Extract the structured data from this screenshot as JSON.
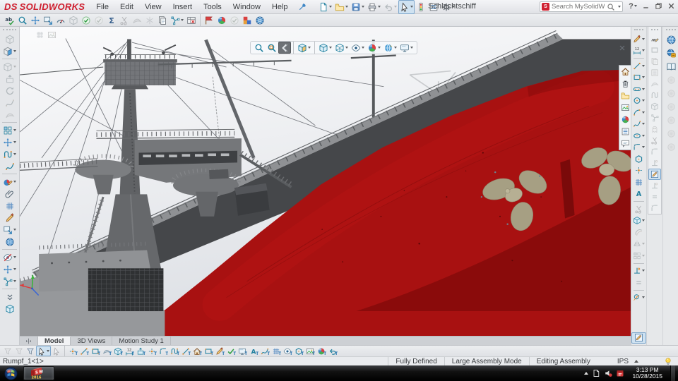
{
  "window": {
    "logo_prefix": "DS",
    "logo_name": "SOLIDWORKS",
    "title": "Schlachtschiff",
    "menus": [
      "File",
      "Edit",
      "View",
      "Insert",
      "Tools",
      "Window",
      "Help"
    ],
    "search_placeholder": "Search MySolidWorks",
    "search_chip": "S",
    "help_label": "?"
  },
  "quick_toolbar": [
    {
      "n": "new-document",
      "g": "page",
      "dd": 1
    },
    {
      "n": "open-document",
      "g": "folder",
      "dd": 1
    },
    {
      "n": "save",
      "g": "floppy",
      "dd": 1
    },
    {
      "n": "print",
      "g": "printer",
      "dd": 1
    },
    {
      "n": "undo",
      "g": "undo",
      "dd": 1,
      "dis": 1
    },
    {
      "n": "select",
      "g": "cursor",
      "dd": 1,
      "sel": 1
    },
    {
      "n": "rebuild",
      "g": "traffic"
    },
    {
      "n": "file-properties",
      "g": "list"
    },
    {
      "n": "options",
      "g": "gear",
      "dd": 1
    }
  ],
  "menu_toolbar": [
    {
      "n": "spell-checker",
      "g": "spell"
    },
    {
      "n": "design-checker",
      "g": "mag"
    },
    {
      "n": "move-component",
      "g": "move"
    },
    {
      "n": "replace-components",
      "g": "windowarrow"
    },
    {
      "n": "measure",
      "g": "gauge"
    },
    {
      "n": "interference-detection",
      "g": "cube",
      "dis": 1
    },
    {
      "n": "check-active-document",
      "g": "checkc"
    },
    {
      "n": "deviation-analysis",
      "g": "checkc",
      "dis": 1
    },
    {
      "n": "equations",
      "g": "sigma"
    },
    {
      "n": "trim-entities",
      "g": "scissors",
      "dis": 1
    },
    {
      "n": "surface-tool",
      "g": "wing",
      "dis": 1
    },
    {
      "n": "freeze-bar",
      "g": "snow",
      "dis": 1
    },
    {
      "n": "copy-settings-wizard",
      "g": "copy"
    },
    {
      "n": "exploded-view",
      "g": "explode",
      "dd": 1
    },
    {
      "n": "delete-face",
      "g": "tablex"
    },
    {
      "sep": 1
    },
    {
      "n": "photoview-preview",
      "g": "flag"
    },
    {
      "n": "motion-manager",
      "g": "ball"
    },
    {
      "n": "verification",
      "g": "checkc",
      "dis": 1
    },
    {
      "n": "edrawings",
      "g": "squares"
    },
    {
      "n": "solidworks-web-help",
      "g": "globe"
    }
  ],
  "left_toolbar": [
    {
      "n": "edit-part",
      "g": "cube",
      "dis": 1
    },
    {
      "n": "edit-component",
      "g": "cube2",
      "dd": 1
    },
    {
      "sep": 1
    },
    {
      "n": "insert-components",
      "g": "cube",
      "dd": 1,
      "dis": 1
    },
    {
      "n": "extruded-boss",
      "g": "extrude",
      "dis": 1
    },
    {
      "n": "revolved-boss",
      "g": "rotate",
      "dis": 1
    },
    {
      "n": "swept-boss",
      "g": "spline",
      "dis": 1
    },
    {
      "n": "lofted-boss",
      "g": "wing",
      "dis": 1
    },
    {
      "sep": 1
    },
    {
      "n": "linear-component-pattern",
      "g": "pattern",
      "dd": 1
    },
    {
      "n": "move-component-tool",
      "g": "move",
      "dd": 1
    },
    {
      "n": "routing-line",
      "g": "route",
      "dd": 1
    },
    {
      "n": "belt-chain",
      "g": "spline"
    },
    {
      "sep": 1
    },
    {
      "n": "edit-appearance",
      "g": "ballpencil",
      "dd": 1
    },
    {
      "n": "attachments",
      "g": "clip"
    },
    {
      "n": "assembly-visualization",
      "g": "patterng"
    },
    {
      "n": "edit-sketch",
      "g": "pencil"
    },
    {
      "n": "preview-window",
      "g": "windowarrow",
      "dd": 1
    },
    {
      "n": "3d-content-central",
      "g": "globe"
    },
    {
      "sep": 1
    },
    {
      "n": "hide-show-components",
      "g": "eyeoff",
      "dd": 1
    },
    {
      "n": "move-component-2",
      "g": "move",
      "dd": 1
    },
    {
      "n": "exploded-view-tool",
      "g": "explode",
      "dd": 1
    },
    {
      "sep": 1
    },
    {
      "n": "more-tools",
      "g": "chevd"
    },
    {
      "n": "component-preview-window",
      "g": "cube"
    }
  ],
  "headsup_toolbar": [
    {
      "n": "zoom-to-fit",
      "g": "mag"
    },
    {
      "n": "zoom-to-area",
      "g": "magarea"
    },
    {
      "n": "previous-view",
      "g": "prevview",
      "sel": 2
    },
    {
      "sep": 1
    },
    {
      "n": "section-view",
      "g": "cubesec",
      "dd": 1
    },
    {
      "sep": 1
    },
    {
      "n": "view-orientation",
      "g": "cube",
      "dd": 1
    },
    {
      "n": "display-style",
      "g": "cubewire",
      "dd": 1
    },
    {
      "n": "hide-show-items",
      "g": "eye",
      "dd": 1
    },
    {
      "n": "edit-appearance-headsup",
      "g": "ball",
      "dd": 1
    },
    {
      "n": "apply-scene",
      "g": "ball2",
      "dd": 1
    },
    {
      "n": "view-settings",
      "g": "monitor",
      "dd": 1
    }
  ],
  "viewport_palette": [
    {
      "n": "solidworks-resources-home",
      "g": "home"
    },
    {
      "n": "recycle-bin",
      "g": "trash"
    },
    {
      "n": "file-explorer-folder",
      "g": "folder"
    },
    {
      "n": "view-palette",
      "g": "image"
    },
    {
      "n": "appearances-palette",
      "g": "ball"
    },
    {
      "n": "custom-properties",
      "g": "list"
    },
    {
      "n": "comments",
      "g": "chat"
    }
  ],
  "float_tools": [
    {
      "n": "view-tool-grid",
      "g": "patterng",
      "dis": 1
    },
    {
      "n": "view-tool-snapshot",
      "g": "image",
      "dis": 1
    }
  ],
  "sketch_toolbar": [
    {
      "n": "sketch-tool",
      "g": "pencil",
      "dd": 1
    },
    {
      "n": "smart-dimension",
      "g": "dim",
      "dd": 1
    },
    {
      "sep": 1
    },
    {
      "n": "line-tool",
      "g": "line",
      "dd": 1
    },
    {
      "n": "corner-rectangle",
      "g": "rect",
      "dd": 1
    },
    {
      "n": "straight-slot",
      "g": "slot",
      "dd": 1
    },
    {
      "n": "circle-tool",
      "g": "circle",
      "dd": 1
    },
    {
      "n": "centerpoint-arc",
      "g": "arc",
      "dd": 1
    },
    {
      "n": "spline-tool",
      "g": "spline",
      "dd": 1
    },
    {
      "n": "ellipse-tool",
      "g": "ellipse",
      "dd": 1
    },
    {
      "n": "sketch-fillet",
      "g": "fillet",
      "dd": 1
    },
    {
      "n": "polygon-tool",
      "g": "polygon"
    },
    {
      "n": "point-tool",
      "g": "point"
    },
    {
      "n": "linear-sketch-pattern",
      "g": "patterng"
    },
    {
      "n": "text-tool",
      "g": "textA"
    },
    {
      "sep": 1
    },
    {
      "n": "trim-entities-sketch",
      "g": "scissors",
      "dis": 1
    },
    {
      "n": "convert-entities",
      "g": "cube",
      "dd": 1
    },
    {
      "n": "offset-entities",
      "g": "offsetE",
      "dis": 1
    },
    {
      "n": "mirror-entities",
      "g": "mirror",
      "dis": 1,
      "dd": 1
    },
    {
      "n": "sketch-pattern",
      "g": "pattern",
      "dd": 1,
      "dis": 1
    },
    {
      "sep": 1
    },
    {
      "n": "display-delete-relations",
      "g": "perp",
      "dd": 1
    },
    {
      "n": "add-relation",
      "g": "eq",
      "dis": 1
    },
    {
      "sep": 1
    },
    {
      "n": "instant-2d",
      "g": "dimc",
      "dd": 1
    },
    {
      "grow": 1
    },
    {
      "n": "exit-sketch",
      "g": "sketchbox",
      "sel": 1
    }
  ],
  "mid_toolbar": [
    {
      "n": "style-spline",
      "g": "pencilM"
    },
    {
      "n": "rapid-sketch",
      "g": "rect",
      "dis": 1
    },
    {
      "n": "copy-entities",
      "g": "copy",
      "dis": 1
    },
    {
      "n": "properties-list",
      "g": "list",
      "dis": 1
    },
    {
      "n": "surface-fill",
      "g": "wing",
      "dis": 1
    },
    {
      "n": "route-sketch",
      "g": "route",
      "dis": 1
    },
    {
      "n": "solid-tool",
      "g": "cube",
      "dis": 1
    },
    {
      "n": "explode-sketch",
      "g": "explode",
      "dis": 1
    },
    {
      "n": "ghost-tool",
      "g": "ghost",
      "dis": 1
    },
    {
      "n": "split-entities",
      "g": "scissors",
      "dis": 1
    },
    {
      "n": "fillet-tool",
      "g": "fillet",
      "dis": 1
    },
    {
      "n": "perpendicular-relation",
      "g": "perp",
      "dis": 1
    },
    {
      "n": "sketch-picture",
      "g": "sketchbox",
      "sel": 1
    },
    {
      "n": "perpendicular-2",
      "g": "perp",
      "dis": 1
    },
    {
      "n": "equal-relation",
      "g": "eq",
      "dis": 1
    },
    {
      "n": "corner-relation",
      "g": "fillet",
      "dis": 1
    }
  ],
  "taskpane_tabs": [
    {
      "n": "solidworks-resources",
      "g": "globe"
    },
    {
      "n": "design-library",
      "g": "globe2"
    },
    {
      "n": "file-explorer",
      "g": "book"
    },
    {
      "n": "view-palette-tab",
      "g": "circleg",
      "dis": 1
    },
    {
      "n": "appearances-scenes",
      "g": "circleg",
      "dis": 1
    },
    {
      "n": "custom-properties-tab",
      "g": "circleg",
      "dis": 1
    },
    {
      "n": "built-in-libraries",
      "g": "circleg",
      "dis": 1
    },
    {
      "n": "forum-tab",
      "g": "circleg",
      "dis": 1
    },
    {
      "n": "extra-tab",
      "g": "circleg",
      "dis": 1
    }
  ],
  "quick_tools_bottom": [
    {
      "n": "filter-vertices",
      "g": "funnel",
      "dis": 1
    },
    {
      "n": "filter-edges",
      "g": "funnel",
      "dis": 1
    },
    {
      "n": "filter-faces",
      "g": "funnel"
    },
    {
      "n": "select-bottom",
      "g": "cursor",
      "sel": 1,
      "dd": 1
    },
    {
      "n": "lasso-select",
      "g": "cursor",
      "dis": 1
    },
    {
      "sep": 1
    },
    {
      "n": "quick-tool-point",
      "g": "point",
      "t": 1
    },
    {
      "n": "quick-tool-line",
      "g": "line",
      "t": 1
    },
    {
      "n": "quick-tool-rect",
      "g": "rect",
      "t": 1
    },
    {
      "n": "quick-tool-surface",
      "g": "wing",
      "t": 1
    },
    {
      "n": "quick-tool-solid",
      "g": "cube",
      "t": 1
    },
    {
      "n": "quick-tool-dimension",
      "g": "dim",
      "t": 1
    },
    {
      "n": "quick-tool-extrude",
      "g": "extrude",
      "t": 1
    },
    {
      "n": "quick-tool-point2",
      "g": "point",
      "t": 1
    },
    {
      "n": "quick-tool-fillet",
      "g": "fillet",
      "t": 1
    },
    {
      "n": "quick-tool-route",
      "g": "route",
      "t": 1
    },
    {
      "n": "quick-tool-line2",
      "g": "line",
      "t": 1
    },
    {
      "n": "quick-tool-home",
      "g": "home",
      "t": 1
    },
    {
      "n": "quick-tool-box",
      "g": "rect",
      "t": 1
    },
    {
      "n": "quick-tool-edit",
      "g": "pencil",
      "t": 1
    },
    {
      "n": "quick-tool-verify",
      "g": "check",
      "t": 1
    },
    {
      "n": "quick-tool-screen",
      "g": "monitor",
      "t": 1
    },
    {
      "n": "quick-tool-text",
      "g": "textA",
      "t": 1
    },
    {
      "n": "quick-tool-spline",
      "g": "spline",
      "t": 1
    },
    {
      "n": "quick-tool-pattern",
      "g": "patterng",
      "t": 1
    },
    {
      "n": "quick-tool-visibility",
      "g": "eye",
      "t": 1
    },
    {
      "n": "quick-tool-polygon",
      "g": "polygon",
      "t": 1
    },
    {
      "n": "quick-tool-image",
      "g": "image",
      "t": 1
    },
    {
      "n": "quick-tool-appearance",
      "g": "ball",
      "t": 1
    },
    {
      "n": "quick-tool-back",
      "g": "undo",
      "t": 1
    }
  ],
  "doc_tabs": {
    "items": [
      "Model",
      "3D Views",
      "Motion Study 1"
    ],
    "active": "Model"
  },
  "statusbar": {
    "component": "Rumpf_1<1>",
    "states": [
      "Fully Defined",
      "Large Assembly Mode",
      "Editing Assembly"
    ],
    "units": "IPS"
  },
  "taskbar": {
    "time": "3:13 PM",
    "date": "10/28/2015",
    "app_letters": "SW",
    "app_year": "2016"
  },
  "colors": {
    "accent_teal": "#1f7f9e",
    "hull_red": "#a81111",
    "hull_dark": "#7a0909",
    "propeller_bronze": "#a69f83",
    "logo_red": "#cf2030",
    "taskbar_bg": "#0c0c0e"
  }
}
